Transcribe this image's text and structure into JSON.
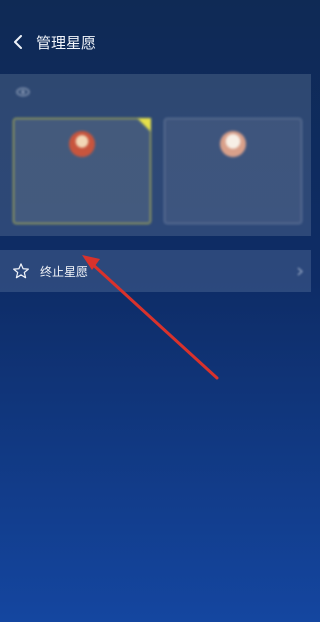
{
  "status_bar": {
    "left_text": "",
    "right_text": ""
  },
  "header": {
    "title": "管理星愿"
  },
  "privacy_section": {
    "heading": "",
    "cards": [
      {
        "title": "",
        "description": "",
        "selected": true,
        "badge_color": "#c8553d"
      },
      {
        "title": "",
        "description": "",
        "selected": false,
        "badge_color": "#d9a08a"
      }
    ]
  },
  "terminate_row": {
    "label": "终止星愿",
    "status": ""
  },
  "annotation": {
    "arrow_color": "#d8322c"
  }
}
